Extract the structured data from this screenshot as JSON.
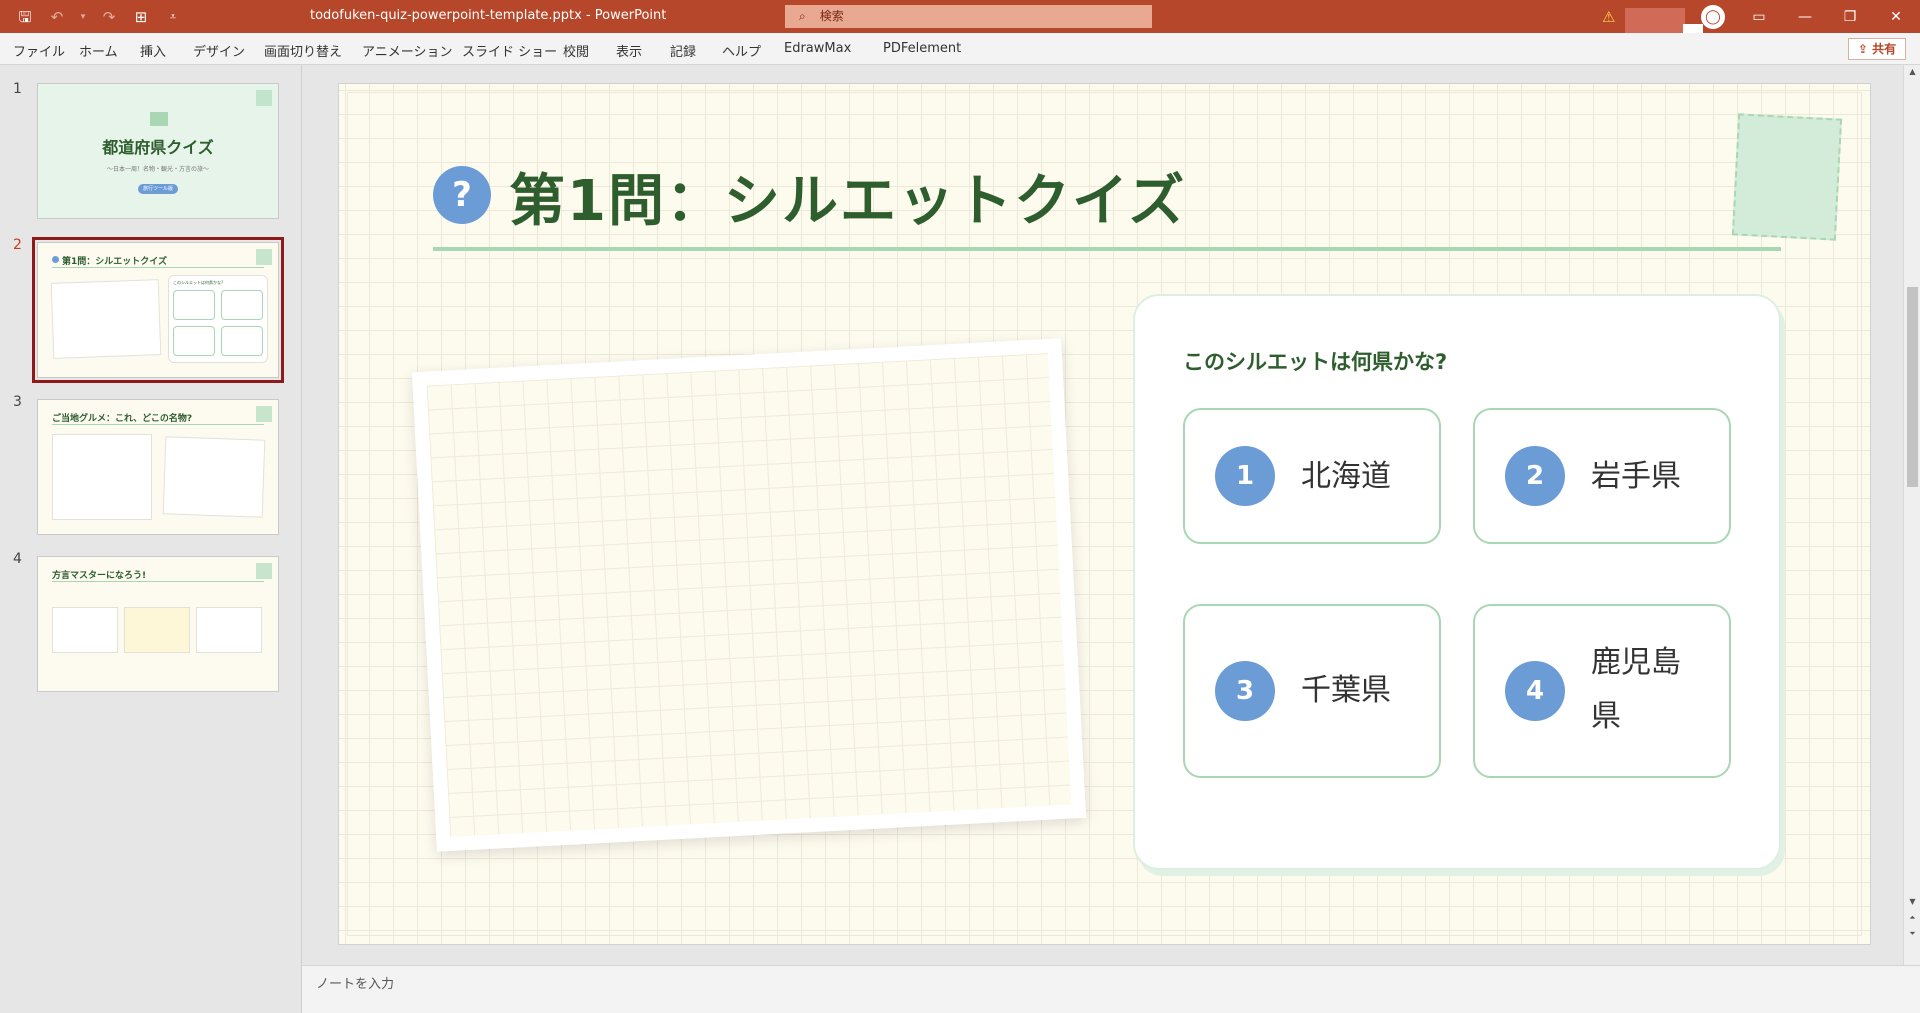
{
  "titlebar": {
    "doc_title": "todofuken-quiz-powerpoint-template.pptx  -  PowerPoint",
    "search_placeholder": "検索"
  },
  "menu": {
    "items": [
      "ファイル",
      "ホーム",
      "挿入",
      "デザイン",
      "画面切り替え",
      "アニメーション",
      "スライド ショー",
      "校閲",
      "表示",
      "記録",
      "ヘルプ",
      "EdrawMax",
      "PDFelement"
    ],
    "share_label": "共有"
  },
  "thumbnails": [
    {
      "num": "1",
      "title": "都道府県クイズ",
      "subtitle": "〜日本一周！名物・観光・方言の旅〜",
      "badge": "旅行ツール版"
    },
    {
      "num": "2",
      "title": "第1問：シルエットクイズ",
      "question": "このシルエットは何県かな?"
    },
    {
      "num": "3",
      "title": "ご当地グルメ：これ、どこの名物?"
    },
    {
      "num": "4",
      "title": "方言マスターになろう!"
    }
  ],
  "slide": {
    "q_icon": "?",
    "title": "第1問：シルエットクイズ",
    "question": "このシルエットは何県かな?",
    "options": [
      {
        "num": "1",
        "label": "北海道"
      },
      {
        "num": "2",
        "label": "岩手県"
      },
      {
        "num": "3",
        "label": "千葉県"
      },
      {
        "num": "4",
        "label": "鹿児島県"
      }
    ]
  },
  "notes": {
    "placeholder": "ノートを入力"
  },
  "colors": {
    "accent": "#b7472a",
    "title_green": "#2e5d2e",
    "option_blue": "#6b9cd6",
    "border_green": "#a9d6b3",
    "slide_bg": "#fdfaee"
  },
  "icons": [
    "save-icon",
    "undo-icon",
    "redo-icon",
    "present-icon",
    "customize-icon",
    "search-icon",
    "warning-icon",
    "user-icon",
    "ribbon-display-icon",
    "minimize-icon",
    "restore-icon",
    "close-icon",
    "share-icon"
  ]
}
